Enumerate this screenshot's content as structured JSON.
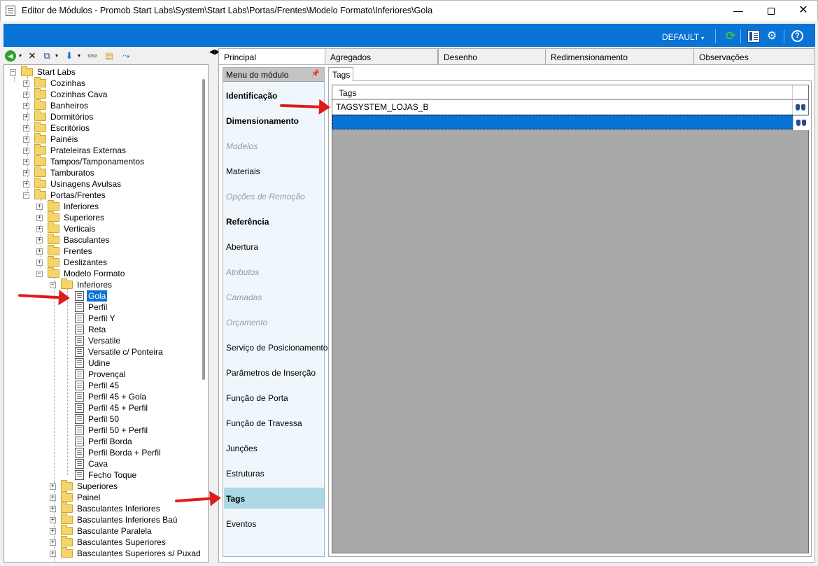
{
  "window": {
    "title": "Editor de Módulos - Promob Start Labs\\System\\Start Labs\\Portas/Frentes\\Modelo Formato\\Inferiores\\Gola",
    "min_glyph": "—",
    "close_glyph": "✕"
  },
  "toolbar": {
    "profile_label": "DEFAULT",
    "caret": "▾",
    "refresh_glyph": "⟳",
    "gears_glyph": "⚙",
    "help_glyph": "?"
  },
  "tree_tools": {
    "back_glyph": "◀",
    "delete_glyph": "✕",
    "copy_glyph": "⧉",
    "move_glyph": "⬇",
    "find_glyph": "👓",
    "folder_glyph": "▤",
    "link_glyph": "⤳",
    "caret": "▾"
  },
  "tree": {
    "root": "Start Labs",
    "level1": [
      "Cozinhas",
      "Cozinhas Cava",
      "Banheiros",
      "Dormitórios",
      "Escritórios",
      "Painéis",
      "Prateleiras Externas",
      "Tampos/Tamponamentos",
      "Tamburatos",
      "Usinagens Avulsas",
      "Portas/Frentes"
    ],
    "portas_children": [
      "Inferiores",
      "Superiores",
      "Verticais",
      "Basculantes",
      "Frentes",
      "Deslizantes",
      "Modelo Formato"
    ],
    "modelo_folder": "Inferiores",
    "modelo_items": [
      "Gola",
      "Perfil",
      "Perfil Y",
      "Reta",
      "Versatile",
      "Versatile c/ Ponteira",
      "Udine",
      "Provençal",
      "Perfil 45",
      "Perfil 45 + Gola",
      "Perfil 45 + Perfil",
      "Perfil 50",
      "Perfil 50 + Perfil",
      "Perfil Borda",
      "Perfil Borda + Perfil",
      "Cava",
      "Fecho Toque"
    ],
    "modelo_others": [
      "Superiores",
      "Painel",
      "Basculantes Inferiores",
      "Basculantes Inferiores Baú",
      "Basculante Paralela",
      "Basculantes Superiores",
      "Basculantes Superiores s/ Puxador"
    ]
  },
  "splitter_glyph": "◀▶",
  "tabs": [
    "Principal",
    "Agregados",
    "Desenho",
    "Redimensionamento",
    "Observações"
  ],
  "menu": {
    "title": "Menu do módulo",
    "pin_glyph": "📌",
    "items": [
      {
        "label": "Identificação",
        "style": "bold"
      },
      {
        "label": "Dimensionamento",
        "style": "bold"
      },
      {
        "label": "Modelos",
        "style": "disabled"
      },
      {
        "label": "Materiais",
        "style": "normal"
      },
      {
        "label": "Opções de Remoção",
        "style": "disabled"
      },
      {
        "label": "Referência",
        "style": "bold"
      },
      {
        "label": "Abertura",
        "style": "normal"
      },
      {
        "label": "Atributos",
        "style": "disabled"
      },
      {
        "label": "Camadas",
        "style": "disabled"
      },
      {
        "label": "Orçamento",
        "style": "disabled"
      },
      {
        "label": "Serviço de Posicionamento",
        "style": "normal"
      },
      {
        "label": "Parâmetros de Inserção",
        "style": "normal"
      },
      {
        "label": "Função de Porta",
        "style": "normal"
      },
      {
        "label": "Função de Travessa",
        "style": "normal"
      },
      {
        "label": "Junções",
        "style": "normal"
      },
      {
        "label": "Estruturas",
        "style": "normal"
      },
      {
        "label": "Tags",
        "style": "bold"
      },
      {
        "label": "Eventos",
        "style": "normal"
      }
    ]
  },
  "tags_panel": {
    "tab_label": "Tags",
    "column_header": "Tags",
    "rows": [
      {
        "value": "TAGSYSTEM_LOJAS_B"
      },
      {
        "value": ""
      }
    ]
  }
}
